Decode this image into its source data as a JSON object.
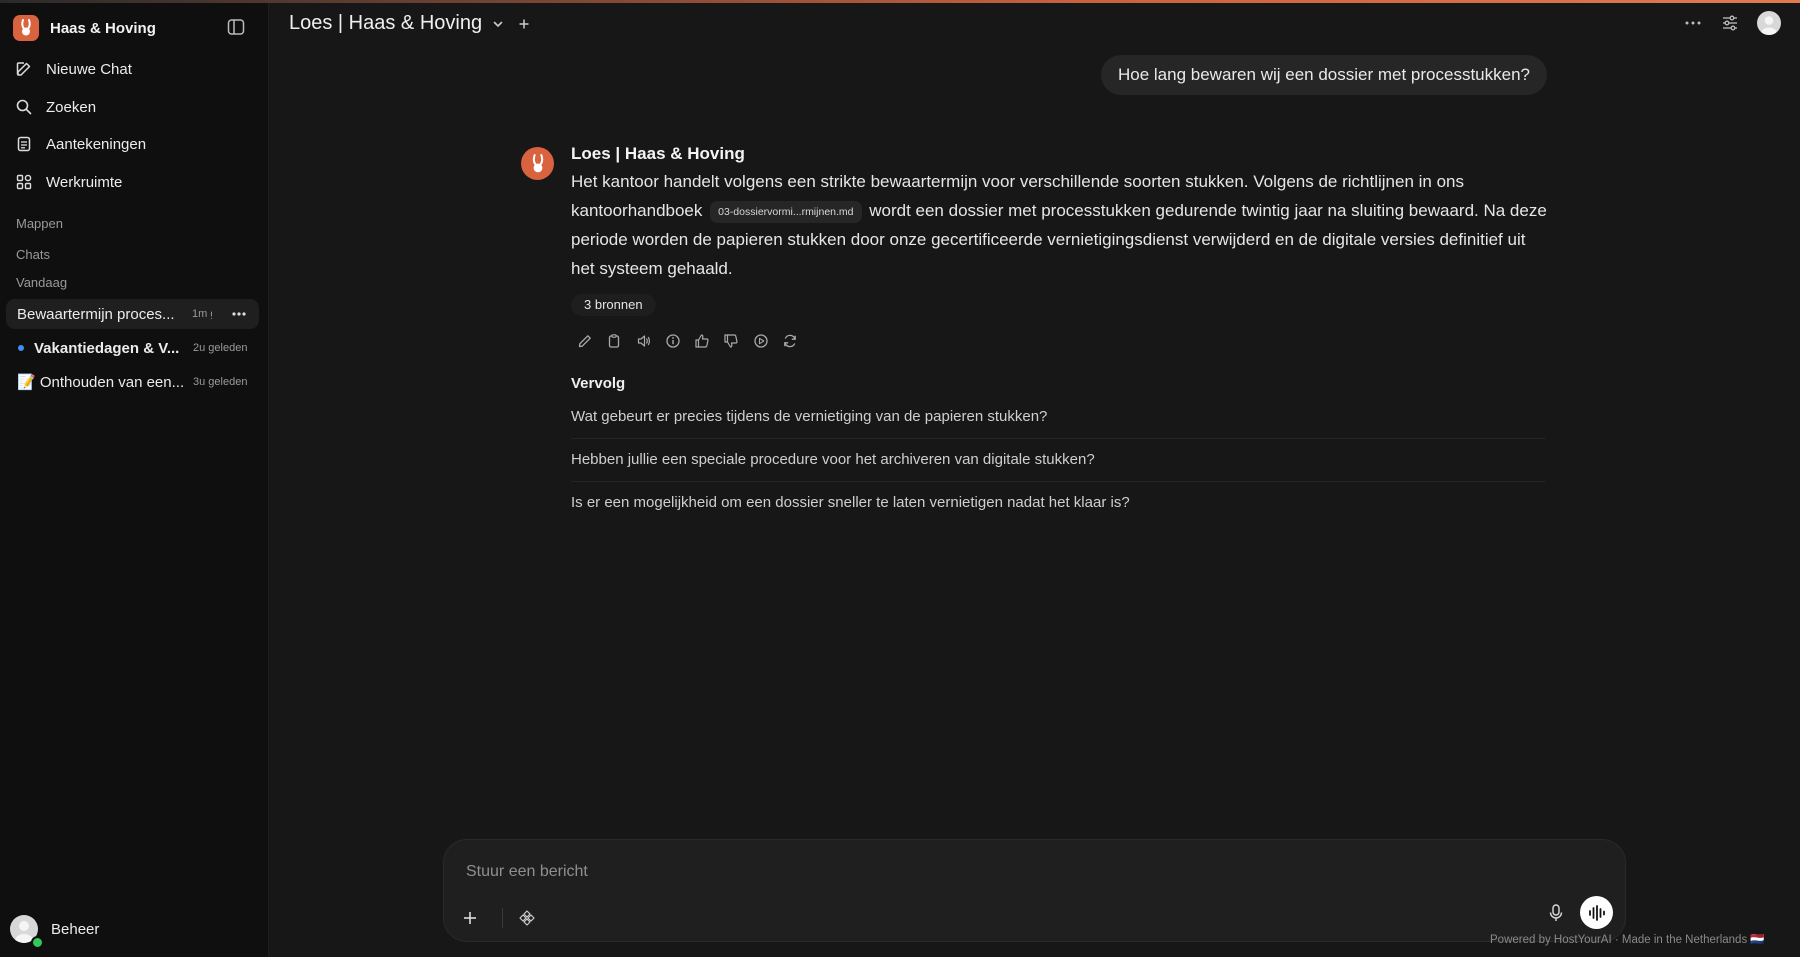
{
  "app": {
    "name": "Haas & Hoving",
    "logo_icon": "rabbit-icon",
    "accent_color": "#d9623f"
  },
  "sidebar": {
    "nav": [
      {
        "label": "Nieuwe Chat",
        "icon": "edit-icon"
      },
      {
        "label": "Zoeken",
        "icon": "search-icon"
      },
      {
        "label": "Aantekeningen",
        "icon": "notes-icon"
      },
      {
        "label": "Werkruimte",
        "icon": "workspace-icon"
      }
    ],
    "sections": {
      "folders": "Mappen",
      "chats": "Chats",
      "today": "Vandaag"
    },
    "chats": [
      {
        "title": "Bewaartermijn proces...",
        "time": "1m g",
        "active": true
      },
      {
        "title": "Vakantiedagen & V...",
        "time": "2u geleden",
        "unread": true
      },
      {
        "title": "📝 Onthouden van een...",
        "time": "3u geleden"
      }
    ],
    "user": {
      "name": "Beheer",
      "status_color": "#34c759"
    }
  },
  "header": {
    "model_title": "Loes | Haas & Hoving"
  },
  "conversation": {
    "user_message": "Hoe lang bewaren wij een dossier met processtukken?",
    "assistant": {
      "name": "Loes | Haas & Hoving",
      "text_before_file": "Het kantoor handelt volgens een strikte bewaartermijn voor verschillende soorten stukken. Volgens de richtlijnen in ons kantoorhandboek",
      "file_chip": "03-dossiervormi...rmijnen.md",
      "text_after_file": "wordt een dossier met processtukken gedurende twintig jaar na sluiting bewaard. Na deze periode worden de papieren stukken door onze gecertificeerde vernietigingsdienst verwijderd en de digitale versies definitief uit het systeem gehaald.",
      "sources_label": "3 bronnen",
      "actions": [
        "edit-icon",
        "copy-icon",
        "speaker-icon",
        "info-icon",
        "thumbs-up-icon",
        "thumbs-down-icon",
        "play-icon",
        "regenerate-icon"
      ]
    },
    "followup": {
      "title": "Vervolg",
      "items": [
        "Wat gebeurt er precies tijdens de vernietiging van de papieren stukken?",
        "Hebben jullie een speciale procedure voor het archiveren van digitale stukken?",
        "Is er een mogelijkheid om een dossier sneller te laten vernietigen nadat het klaar is?"
      ]
    }
  },
  "composer": {
    "placeholder": "Stuur een bericht"
  },
  "footer": {
    "note": "Powered by HostYourAI · Made in the Netherlands 🇳🇱"
  }
}
